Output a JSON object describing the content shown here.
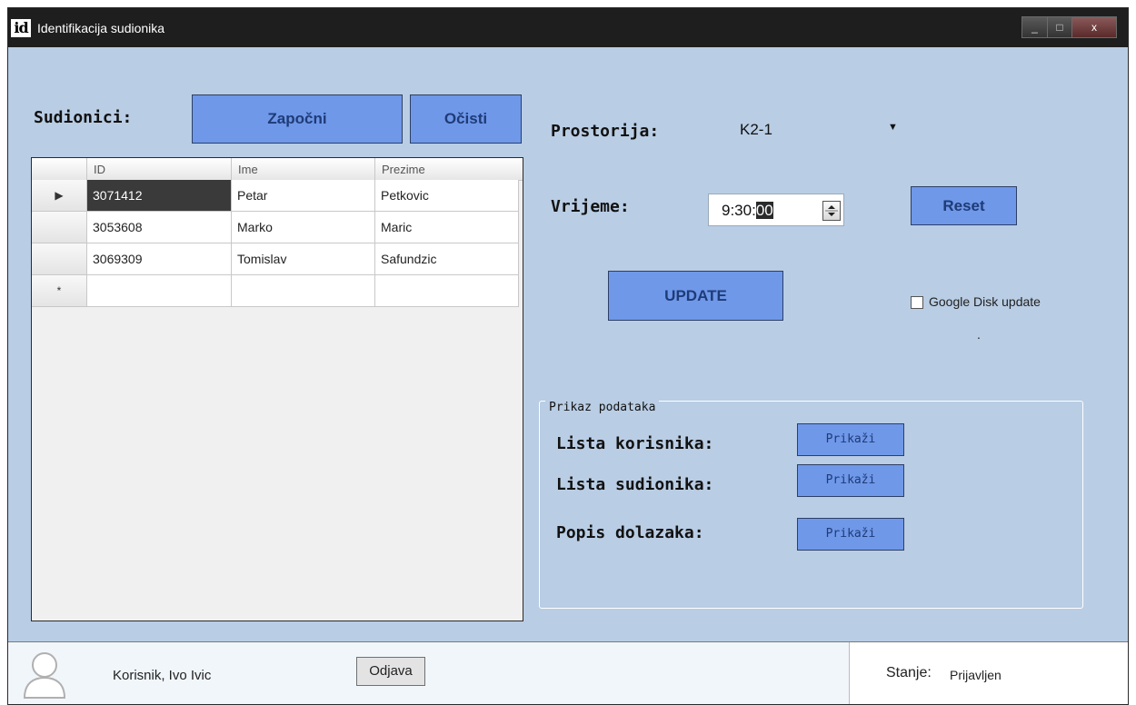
{
  "window": {
    "title": "Identifikacija sudionika",
    "app_icon": "id",
    "controls": {
      "minimize": "_",
      "maximize": "□",
      "close": "x"
    }
  },
  "participants": {
    "label": "Sudionici:",
    "start_button": "Započni",
    "clear_button": "Očisti",
    "columns": [
      "ID",
      "Ime",
      "Prezime"
    ],
    "rows": [
      {
        "id": "3071412",
        "ime": "Petar",
        "prezime": "Petkovic"
      },
      {
        "id": "3053608",
        "ime": "Marko",
        "prezime": "Maric"
      },
      {
        "id": "3069309",
        "ime": "Tomislav",
        "prezime": "Safundzic"
      }
    ],
    "new_row_marker": "*",
    "current_row_marker": "▶"
  },
  "room": {
    "label": "Prostorija:",
    "value": "K2-1"
  },
  "time": {
    "label": "Vrijeme:",
    "value_prefix": "9:30:",
    "value_selected": "00",
    "reset_button": "Reset"
  },
  "update": {
    "button": "UPDATE",
    "google_disk_label": "Google Disk update",
    "google_disk_checked": false,
    "dot": "."
  },
  "data_view": {
    "group_title": "Prikaz podataka",
    "items": [
      {
        "label": "Lista korisnika:",
        "button": "Prikaži"
      },
      {
        "label": "Lista sudionika:",
        "button": "Prikaži"
      },
      {
        "label": "Popis dolazaka:",
        "button": "Prikaži"
      }
    ]
  },
  "status": {
    "user": "Korisnik, Ivo Ivic",
    "logout_button": "Odjava",
    "state_label": "Stanje:",
    "state_value": "Prijavljen"
  },
  "colors": {
    "background": "#b9cde4",
    "button": "#6f98e9",
    "button_text": "#1f3b77",
    "titlebar": "#1e1e1e"
  }
}
